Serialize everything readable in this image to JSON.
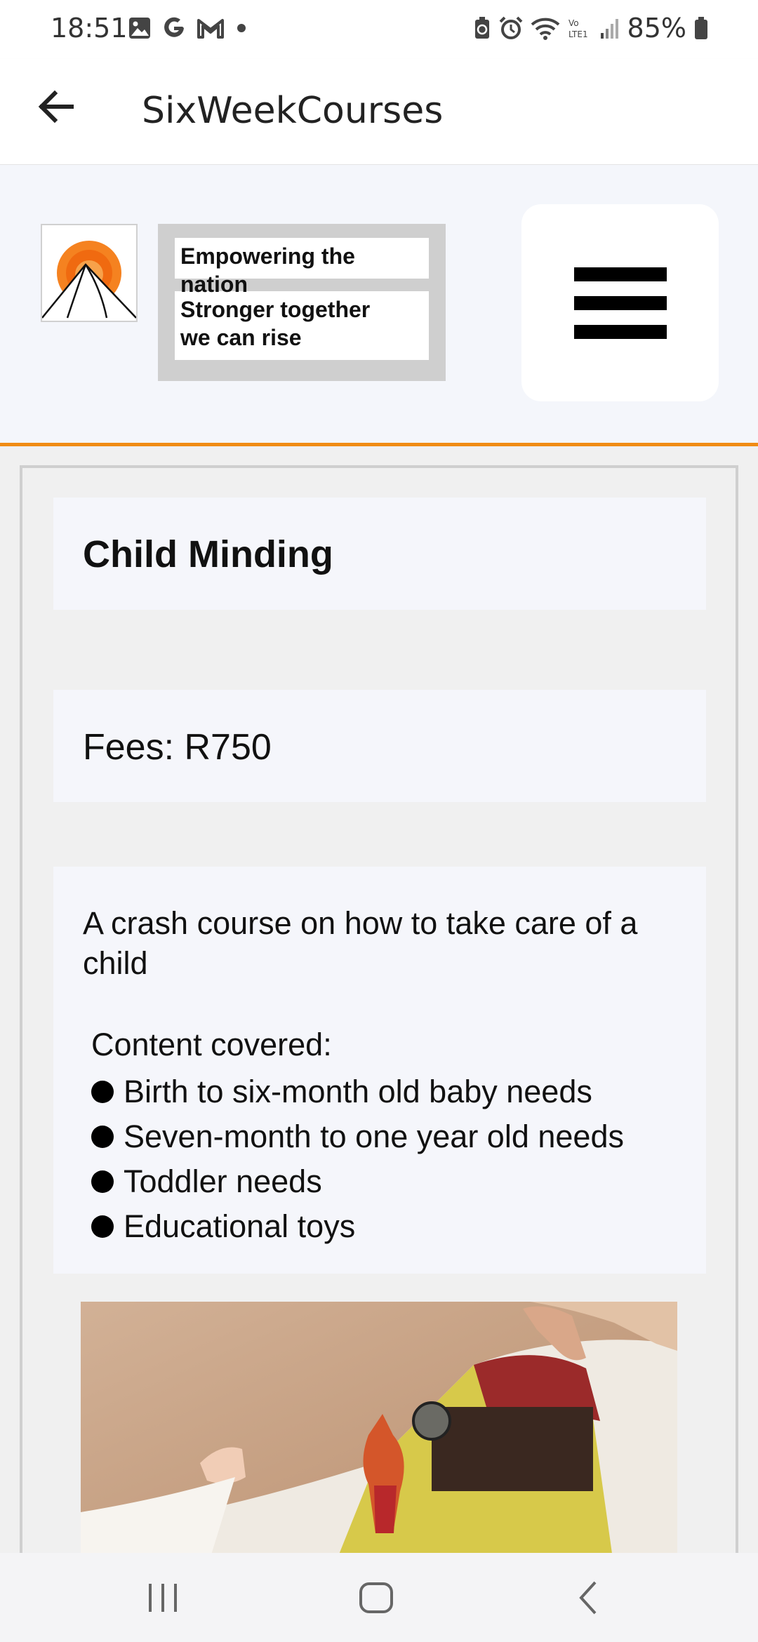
{
  "status_bar": {
    "time": "18:51",
    "left_icons": [
      "image-icon",
      "google-g-icon",
      "gmail-icon",
      "dot-icon"
    ],
    "right_icons": [
      "battery-saver-icon",
      "alarm-icon",
      "wifi-icon",
      "volte-icon",
      "signal-icon"
    ],
    "battery": "85%"
  },
  "app_bar": {
    "title": "SixWeekCourses",
    "back_icon": "arrow-back-icon"
  },
  "site_header": {
    "taglines": [
      "Empowering the nation",
      "Stronger together\nwe can rise"
    ],
    "menu_icon": "hamburger-menu-icon",
    "accent_color": "#f08c14"
  },
  "course": {
    "title": "Child Minding",
    "fees": "Fees: R750",
    "description": "A crash course on how to take care of a child",
    "content_heading": "Content covered:",
    "content_items": [
      "Birth to six-month old baby needs",
      "Seven-month to one year old needs",
      "Toddler needs",
      "Educational toys"
    ]
  },
  "nav_bar": {
    "icons": [
      "recent-apps-icon",
      "home-icon",
      "back-icon"
    ]
  }
}
